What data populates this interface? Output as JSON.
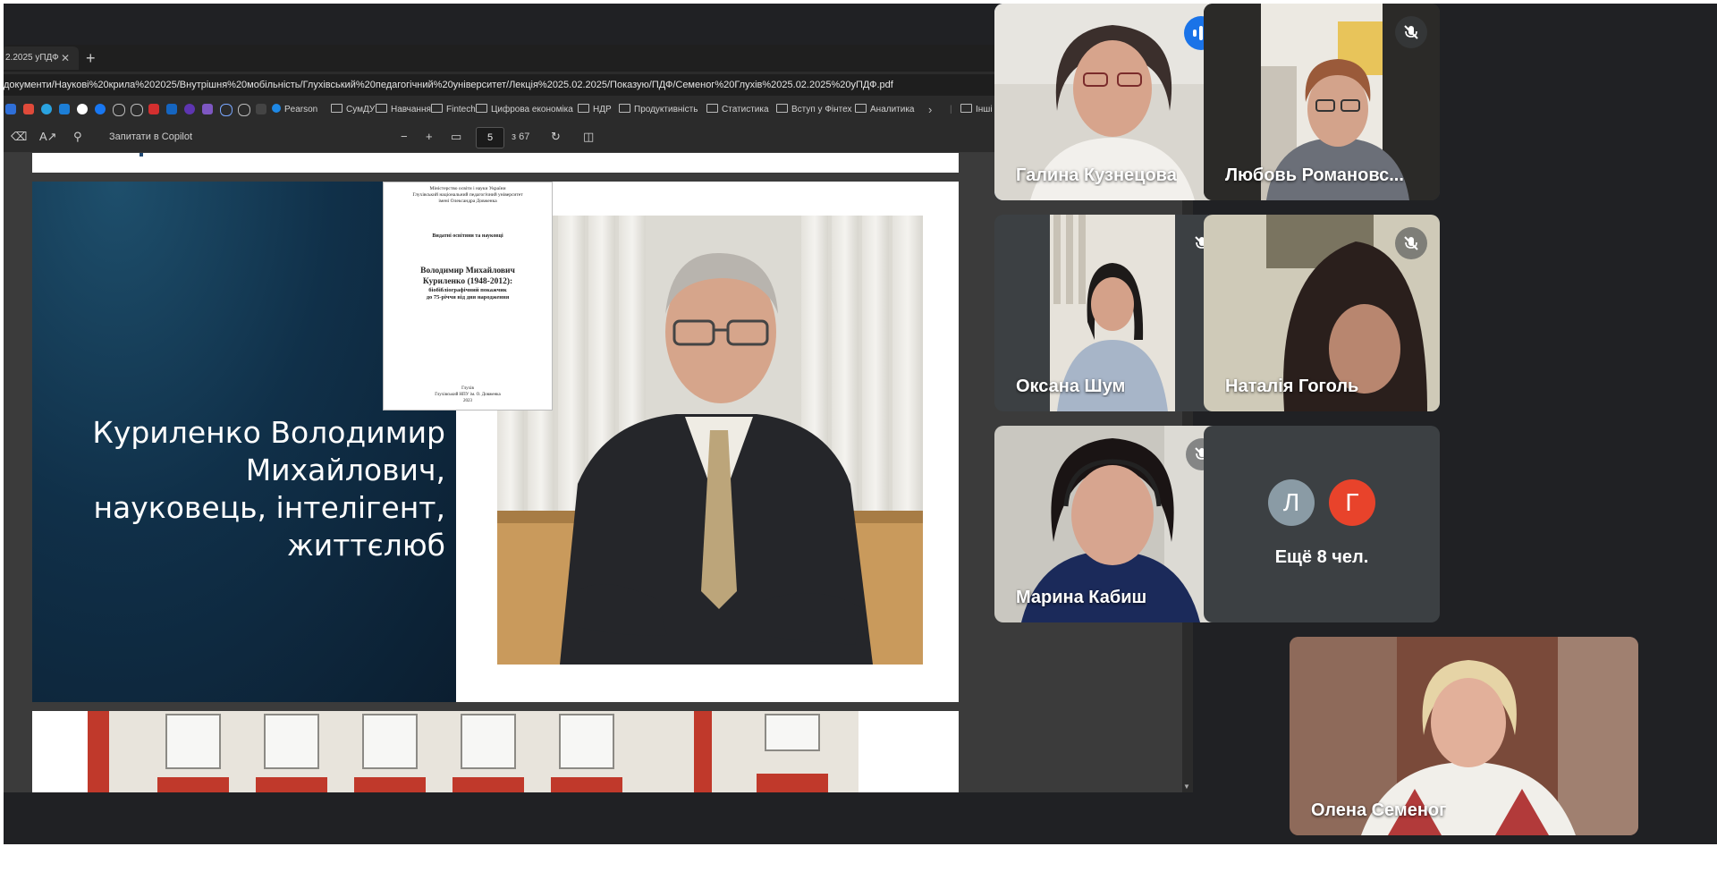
{
  "browser": {
    "tab_title": "2.2025 yПДФ",
    "url": "документи/Наукові%20крила%202025/Внутрішня%20мобільність/Глухівський%20педагогічний%20університет/Лекція%2025.02.2025/Показую/ПДФ/Семеног%20Глухів%2025.02.2025%20уПДФ.pdf",
    "bookmarks": [
      "Pearson",
      "СумДУ",
      "Навчання",
      "Fintech",
      "Цифрова економіка",
      "НДР",
      "Продуктивність",
      "Статистика",
      "Вступ у Фінтех",
      "Аналитика",
      "Інші вподобання"
    ]
  },
  "pdf_toolbar": {
    "ask_copilot": "Запитати в Copilot",
    "current_page": "5",
    "total_pages": "з 67"
  },
  "slide": {
    "title_lines": [
      "Куриленко Володимир",
      "Михайлович,",
      "науковець, інтелігент,",
      "життєлюб"
    ],
    "book": {
      "header": [
        "Міністерство освіти і науки України",
        "Глухівський національний педагогічний університет",
        "імені Олександра Довженка"
      ],
      "series": "Видатні освітяни та науковці",
      "title": [
        "Володимир Михайлович",
        "Куриленко (1948-2012):"
      ],
      "subtitle": [
        "біобібліографічний покажчик",
        "до 75-річчя від дня народження"
      ],
      "imprint": [
        "Глухів",
        "Глухівський НПУ ім. О. Довженка",
        "2023"
      ]
    }
  },
  "meeting": {
    "participants": [
      {
        "name": "Галина Кузнецова",
        "status": "speaking"
      },
      {
        "name": "Любовь Романовс...",
        "status": "muted"
      },
      {
        "name": "Оксана Шум",
        "status": "muted"
      },
      {
        "name": "Наталія Гоголь",
        "status": "muted"
      },
      {
        "name": "Марина Кабиш",
        "status": "muted"
      },
      {
        "name": "Олена Семеног",
        "status": "unmuted"
      }
    ],
    "more_avatars": [
      {
        "initial": "Л",
        "color": "#8a9ba5"
      },
      {
        "initial": "Г",
        "color": "#e8432b"
      }
    ],
    "more_label": "Ещё 8 чел."
  }
}
